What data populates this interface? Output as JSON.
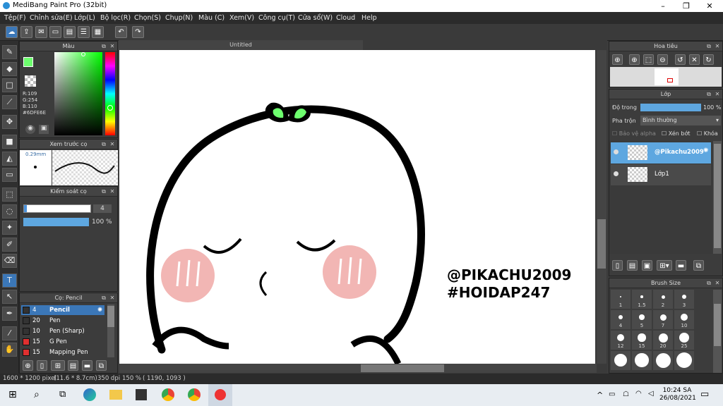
{
  "window": {
    "title": "MediBang Paint Pro (32bit)",
    "minimize": "–",
    "maximize": "❐",
    "close": "✕"
  },
  "menu": [
    "Tệp(F)",
    "Chỉnh sửa(E)",
    "Lớp(L)",
    "Bộ lọc(R)",
    "Chọn(S)",
    "Chụp(N)",
    "Màu (C)",
    "Xem(V)",
    "Công cụ(T)",
    "Cửa sổ(W)",
    "Cloud",
    "Help"
  ],
  "color_panel": {
    "title": "Màu",
    "r": "R:109",
    "g": "G:254",
    "b": "B:110",
    "hex": "#6DFE6E",
    "current_color": "#6dfe6e"
  },
  "brush_preview": {
    "title": "Xem trước cọ",
    "size": "0.29mm"
  },
  "brush_control": {
    "title": "Kiểm soát cọ",
    "size_value": "4",
    "opacity_value": "100 %"
  },
  "brush_list": {
    "title": "Cọ: Pencil",
    "items": [
      {
        "size": "4",
        "name": "Pencil",
        "color": "#333333",
        "selected": true
      },
      {
        "size": "20",
        "name": "Pen",
        "color": "#333333",
        "selected": false
      },
      {
        "size": "10",
        "name": "Pen (Sharp)",
        "color": "#333333",
        "selected": false
      },
      {
        "size": "15",
        "name": "G Pen",
        "color": "#e03030",
        "selected": false
      },
      {
        "size": "15",
        "name": "Mapping Pen",
        "color": "#e03030",
        "selected": false
      }
    ]
  },
  "document": {
    "tab": "Untitled",
    "text_line1": "@PIKACHU2009",
    "text_line2": "#HOIDAP247"
  },
  "navigator": {
    "title": "Hoa tiêu"
  },
  "layers": {
    "title": "Lớp",
    "opacity_label": "Độ trong",
    "opacity_value": "100 %",
    "opacity_fraction": 1.0,
    "blend_label": "Pha trộn",
    "blend_value": "Bình thường",
    "protect_alpha": "Bảo vệ alpha",
    "clip": "Xén bớt",
    "lock": "Khóa",
    "items": [
      {
        "name": "@Pikachu2009",
        "selected": true
      },
      {
        "name": "Lớp1",
        "selected": false
      }
    ]
  },
  "brush_size": {
    "title": "Brush Size",
    "labels": [
      "1",
      "1.5",
      "2",
      "3",
      "4",
      "5",
      "7",
      "10",
      "12",
      "15",
      "20",
      "25"
    ]
  },
  "status": {
    "dims": "1600 * 1200 pixel",
    "physical": "(11.6 * 8.7cm)",
    "dpi": "350 dpi",
    "zoom": "150 %",
    "coords": "( 1190, 1093 )"
  },
  "taskbar": {
    "time": "10:24 SA",
    "date": "26/08/2021"
  }
}
